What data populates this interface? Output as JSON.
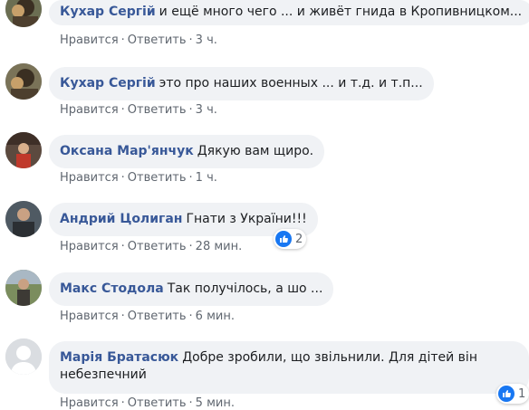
{
  "comments": [
    {
      "author": "Кухар Сергій",
      "text": "и ещё много чего ... и живёт гнида в Кропивницком...",
      "like": "Нравится",
      "reply": "Ответить",
      "time": "3 ч."
    },
    {
      "author": "Кухар Сергій",
      "text": "это про наших военных ... и т.д. и т.п...",
      "like": "Нравится",
      "reply": "Ответить",
      "time": "3 ч."
    },
    {
      "author": "Оксана Мар'янчук",
      "text": "Дякую вам щиро.",
      "like": "Нравится",
      "reply": "Ответить",
      "time": "1 ч."
    },
    {
      "author": "Андрий Цолиган",
      "text": "Гнати з України!!!",
      "like": "Нравится",
      "reply": "Ответить",
      "time": "28 мин.",
      "reactions": "2"
    },
    {
      "author": "Макс Стодола",
      "text": "Так получілось, а шо ...",
      "like": "Нравится",
      "reply": "Ответить",
      "time": "6 мин."
    },
    {
      "author": "Марія Братасюк",
      "text": "Добре зробили, що звільнили. Для дітей він небезпечний",
      "like": "Нравится",
      "reply": "Ответить",
      "time": "5 мин.",
      "reactions": "1"
    }
  ],
  "separator": "·",
  "colors": {
    "author": "#385898",
    "bubble": "#f0f2f5",
    "meta": "#606770",
    "like_badge": "#1877f2"
  }
}
